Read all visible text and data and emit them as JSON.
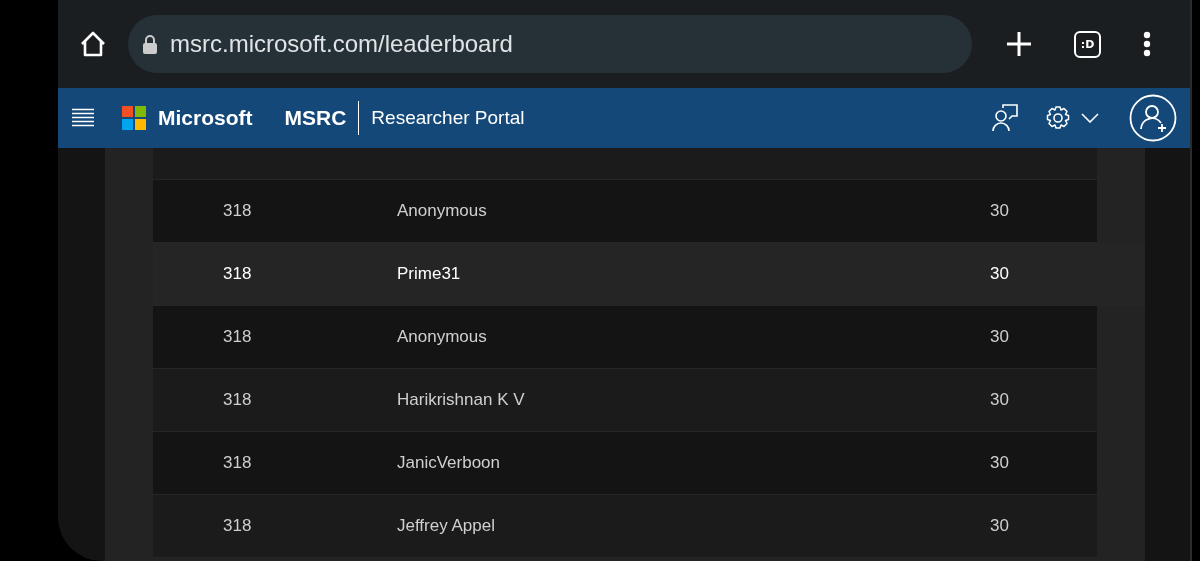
{
  "browser": {
    "url": "msrc.microsoft.com/leaderboard",
    "tab_switcher": ":D"
  },
  "header": {
    "brand": "Microsoft",
    "site": "MSRC",
    "portal": "Researcher Portal"
  },
  "table": {
    "rows": [
      {
        "rank": "318",
        "name": "Anonymous",
        "score": "30",
        "selected": false
      },
      {
        "rank": "318",
        "name": "Prime31",
        "score": "30",
        "selected": true
      },
      {
        "rank": "318",
        "name": "Anonymous",
        "score": "30",
        "selected": false
      },
      {
        "rank": "318",
        "name": "Harikrishnan K V",
        "score": "30",
        "selected": false
      },
      {
        "rank": "318",
        "name": "JanicVerboon",
        "score": "30",
        "selected": false
      },
      {
        "rank": "318",
        "name": "Jeffrey Appel",
        "score": "30",
        "selected": false
      }
    ]
  }
}
